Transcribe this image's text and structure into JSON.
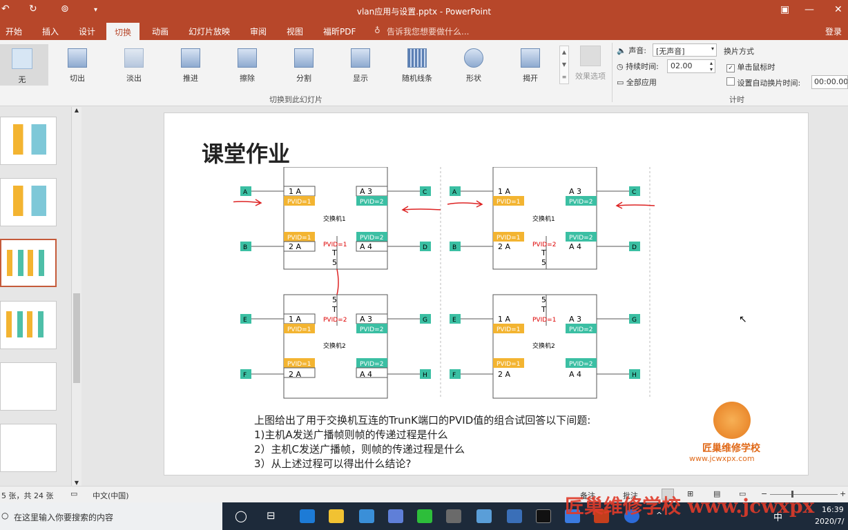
{
  "window": {
    "title": "vlan应用与设置.pptx - PowerPoint",
    "login": "登录"
  },
  "tabs": [
    {
      "label": "开始"
    },
    {
      "label": "插入"
    },
    {
      "label": "设计"
    },
    {
      "label": "切换"
    },
    {
      "label": "动画"
    },
    {
      "label": "幻灯片放映"
    },
    {
      "label": "审阅"
    },
    {
      "label": "视图"
    },
    {
      "label": "福昕PDF"
    }
  ],
  "tell_me": "告诉我您想要做什么...",
  "transitions": {
    "items": [
      {
        "label": "无"
      },
      {
        "label": "切出"
      },
      {
        "label": "淡出"
      },
      {
        "label": "推进"
      },
      {
        "label": "擦除"
      },
      {
        "label": "分割"
      },
      {
        "label": "显示"
      },
      {
        "label": "随机线条"
      },
      {
        "label": "形状"
      },
      {
        "label": "揭开"
      }
    ],
    "group_label": "切换到此幻灯片",
    "effect_options": "效果选项"
  },
  "timing": {
    "sound_label": "声音:",
    "sound_value": "[无声音]",
    "duration_label": "持续时间:",
    "duration_value": "02.00",
    "apply_all": "全部应用",
    "advance_title": "换片方式",
    "on_click": "单击鼠标时",
    "auto_after": "设置自动换片时间:",
    "auto_value": "00:00.00",
    "group_label": "计时"
  },
  "slide": {
    "title": "课堂作业",
    "questions": [
      "上图给出了用于交换机互连的TrunK端口的PVID值的组合试回答以下间题:",
      "1)主机A发送广播帧则帧的传递过程是什么",
      "2）主机C发送广播帧，则帧的传递过程是什么",
      "3）从上述过程可以得出什么结论?"
    ],
    "logo_text": "匠巢维修学校",
    "logo_url": "www.jcwxpx.com"
  },
  "diagram": {
    "switch1": "交换机1",
    "switch2": "交换机2",
    "hosts": [
      "A",
      "B",
      "C",
      "D",
      "E",
      "F",
      "G",
      "H"
    ],
    "pvid1": "PVID=1",
    "pvid2": "PVID=2",
    "port1A": "1  A",
    "port2A": "2  A",
    "portA3": "A  3",
    "portA4": "A  4",
    "trunk5T": [
      "5",
      "T"
    ],
    "trunk_pvid_left": "PVID=1",
    "trunk_pvid_left_b": "PVID=2",
    "trunk_pvid_right_top": "PVID=2",
    "trunk_pvid_right_b": "PVID=1"
  },
  "status": {
    "slide_count": "5 张，共 24 张",
    "language": "中文(中国)",
    "notes": "备注",
    "comments": "批注"
  },
  "taskbar": {
    "search": "在这里输入你要搜索的内容",
    "time": "16:39",
    "date": "2020/7/",
    "ime": "中"
  },
  "watermark": "匠巢维修学校  www.jcwxpx"
}
